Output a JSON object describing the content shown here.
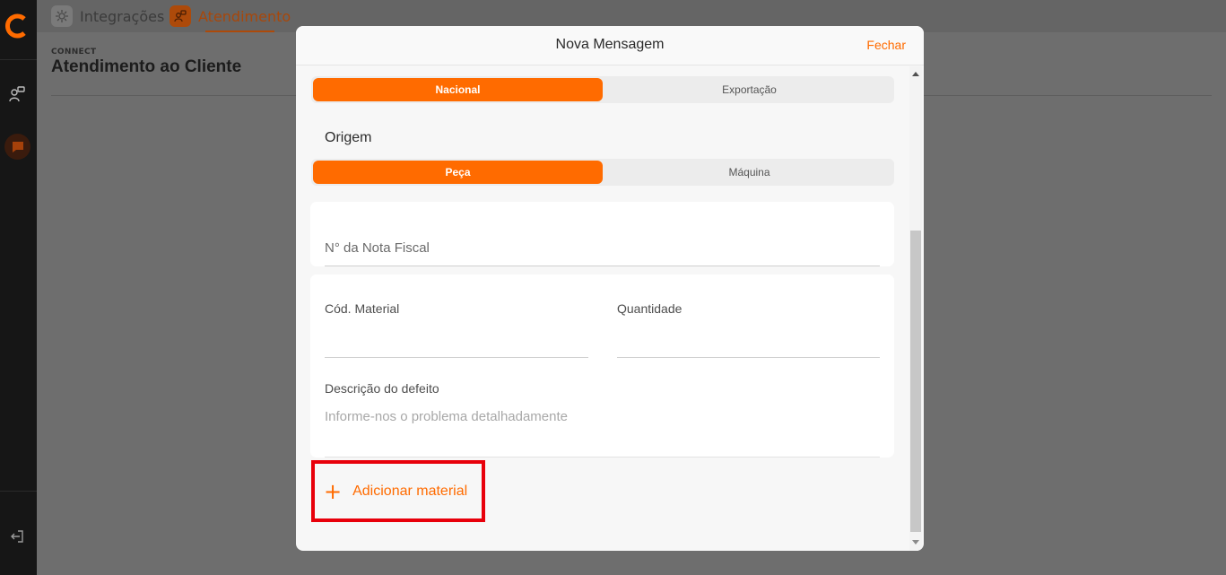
{
  "nav": {
    "tabs": [
      {
        "label": "Integrações",
        "icon": "integrations-icon",
        "active": false
      },
      {
        "label": "Atendimento",
        "icon": "support-icon",
        "active": true
      }
    ]
  },
  "page": {
    "breadcrumb": "CONNECT",
    "title": "Atendimento ao Cliente"
  },
  "modal": {
    "title": "Nova Mensagem",
    "close_label": "Fechar",
    "market_toggle": {
      "options": [
        "Nacional",
        "Exportação"
      ],
      "selected": "Nacional"
    },
    "origin": {
      "label": "Origem",
      "options": [
        "Peça",
        "Máquina"
      ],
      "selected": "Peça"
    },
    "invoice": {
      "placeholder": "N° da Nota Fiscal"
    },
    "material": {
      "code_label": "Cód. Material",
      "quantity_label": "Quantidade",
      "defect_label": "Descrição do defeito",
      "defect_placeholder": "Informe-nos o problema detalhadamente"
    },
    "add_material_label": "Adicionar material"
  },
  "colors": {
    "accent": "#ff6b00",
    "highlight_box": "#e8000b",
    "sidebar_bg": "#161616",
    "overlay": "#6b6b6b"
  }
}
